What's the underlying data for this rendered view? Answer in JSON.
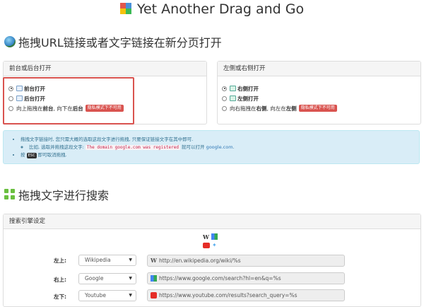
{
  "header": {
    "title": "Yet Another Drag and Go"
  },
  "section1": {
    "heading": "拖拽URL链接或者文字链接在新分页打开",
    "left_panel": {
      "title": "前台或后台打开",
      "options": [
        {
          "label": "前台打开",
          "selected": true
        },
        {
          "label": "后台打开",
          "selected": false
        }
      ],
      "option3_prefix": "向上拖拽在",
      "option3_bold1": "前台",
      "option3_mid": ", 向下在",
      "option3_bold2": "后台",
      "badge": "隐私模式下不可用"
    },
    "right_panel": {
      "title": "左侧或右侧打开",
      "options": [
        {
          "label": "右侧打开",
          "selected": true
        },
        {
          "label": "左侧打开",
          "selected": false
        }
      ],
      "option3_prefix": "向右拖拽在",
      "option3_bold1": "右侧",
      "option3_mid": ", 向左在",
      "option3_bold2": "左侧",
      "badge": "隐私模式下不可用"
    },
    "info": {
      "line1": "拖拽文字链接时, 您只需大概的选取这段文字进行拖拽, 只要保证链接文字在其中即可.",
      "line2_prefix": "比如, 选取并拖拽这段文字: ",
      "line2_code": "The domain google.com was registered",
      "line2_mid": " 就可以打开 ",
      "line2_link": "google.com",
      "line2_suffix": ".",
      "line3_prefix": "按 ",
      "line3_key": "ESC",
      "line3_suffix": " 即可取消拖拽."
    }
  },
  "section2": {
    "heading": "拖拽文字进行搜索",
    "panel_title": "搜索引擎设定",
    "rows": [
      {
        "label": "左上:",
        "engine": "Wikipedia",
        "url": "http://en.wikipedia.org/wiki/%s",
        "icon": "wikipedia-icon"
      },
      {
        "label": "右上:",
        "engine": "Google",
        "url": "https://www.google.com/search?hl=en&q=%s",
        "icon": "google-icon"
      },
      {
        "label": "左下:",
        "engine": "Youtube",
        "url": "https://www.youtube.com/results?search_query=%s",
        "icon": "youtube-icon"
      }
    ]
  },
  "colors": {
    "danger": "#d9534f",
    "info_bg": "#d9edf7",
    "link": "#337ab7"
  }
}
